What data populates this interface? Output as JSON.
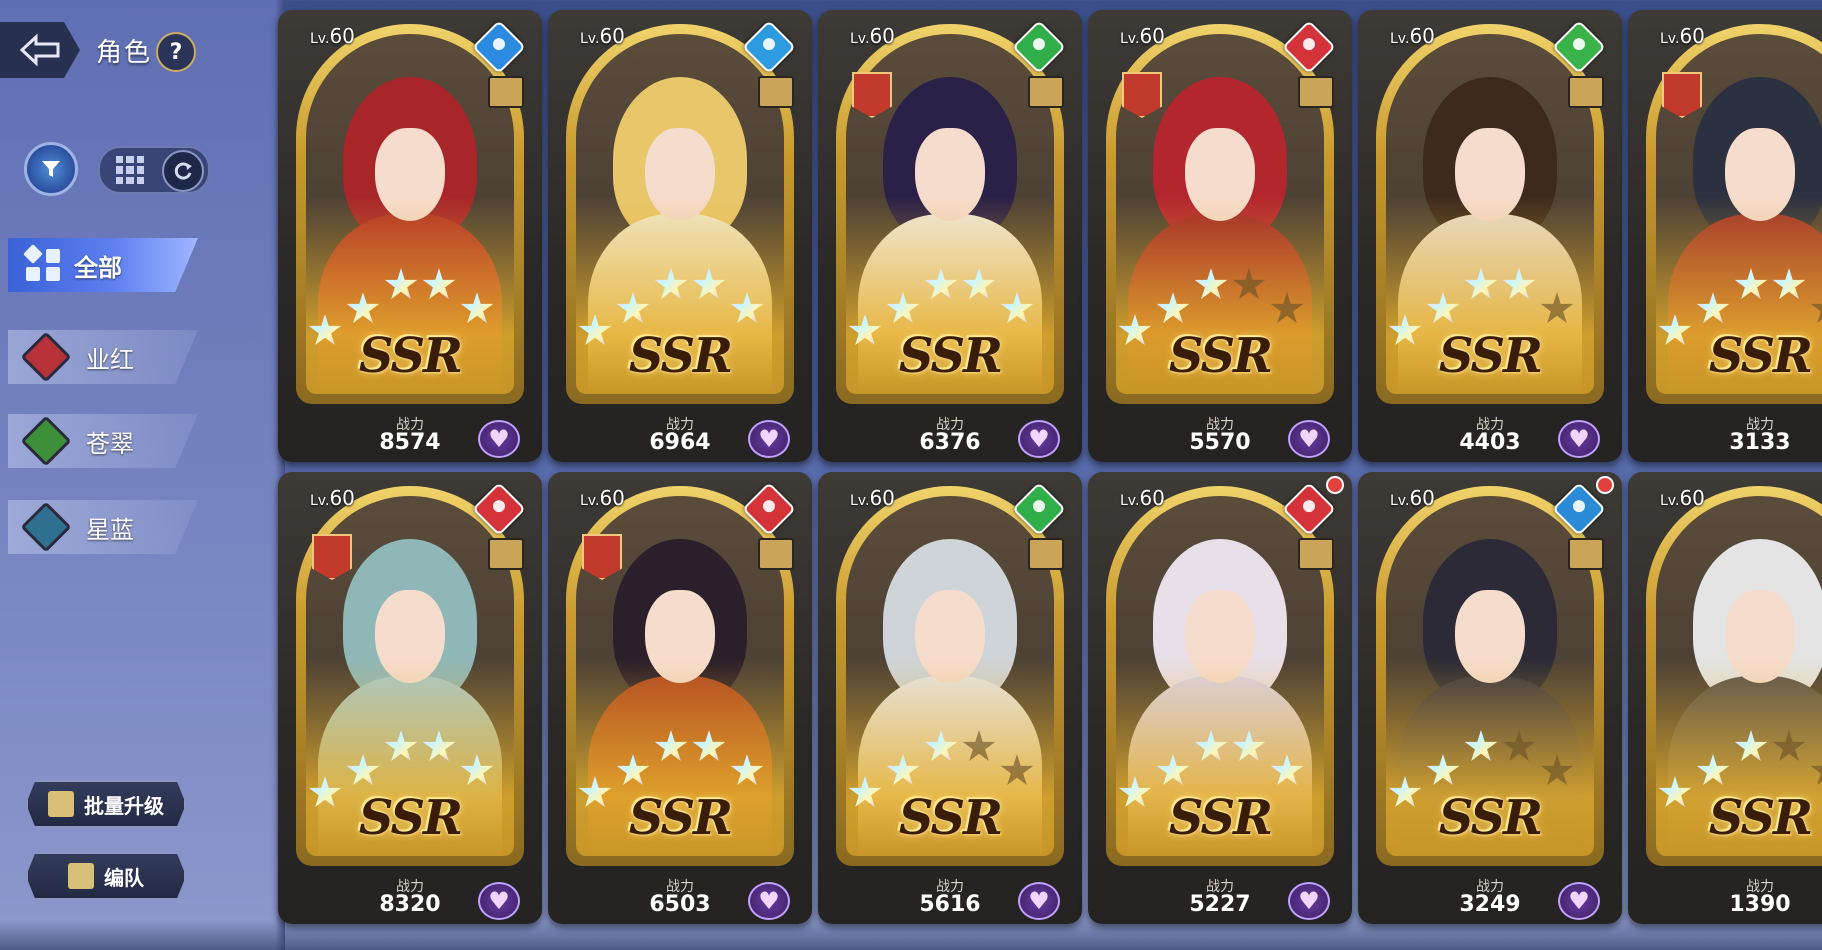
{
  "header": {
    "title": "角色",
    "help": "?"
  },
  "categories": [
    {
      "label": "全部",
      "active": true
    },
    {
      "label": "业红",
      "color": "#b8323a"
    },
    {
      "label": "苍翠",
      "color": "#3e8f3a"
    },
    {
      "label": "星蓝",
      "color": "#2f6f8f"
    }
  ],
  "buttons": {
    "batch_upgrade": "批量升级",
    "formation": "编队"
  },
  "card_common": {
    "level": "60",
    "level_prefix": "Lv.",
    "rarity": "SSR",
    "power_label": "战力"
  },
  "cards": [
    {
      "power": "8574",
      "element_color": "#2b8be0",
      "element": "water-icon",
      "badge": false,
      "stars_on": 5,
      "hair": "#a8262a",
      "body": "#b43528",
      "red_dot": false
    },
    {
      "power": "6964",
      "element_color": "#2c9be0",
      "element": "ice-icon",
      "badge": false,
      "stars_on": 5,
      "hair": "#e8c66a",
      "body": "#efe7c8",
      "red_dot": false
    },
    {
      "power": "6376",
      "element_color": "#2fae4a",
      "element": "leaf-icon",
      "badge": true,
      "stars_on": 5,
      "hair": "#2a2048",
      "body": "#f0eadc",
      "red_dot": false
    },
    {
      "power": "5570",
      "element_color": "#d4333a",
      "element": "shield-icon",
      "badge": true,
      "stars_on": 3,
      "hair": "#b3262e",
      "body": "#a32a2a",
      "red_dot": false
    },
    {
      "power": "4403",
      "element_color": "#39b24a",
      "element": "sword-icon",
      "badge": false,
      "stars_on": 4,
      "hair": "#3d2a1e",
      "body": "#e7dccb",
      "red_dot": false
    },
    {
      "power": "3133",
      "element_color": "#d4333a",
      "element": "shield-icon",
      "badge": true,
      "stars_on": 4,
      "hair": "#2b3140",
      "body": "#a2362c",
      "red_dot": false
    },
    {
      "power": "8320",
      "element_color": "#d4333a",
      "element": "sword-icon",
      "badge": true,
      "stars_on": 5,
      "hair": "#8fb7b8",
      "body": "#a9c9c9",
      "red_dot": false
    },
    {
      "power": "6503",
      "element_color": "#d4333a",
      "element": "fire-icon",
      "badge": true,
      "stars_on": 5,
      "hair": "#2a1f2a",
      "body": "#b24a22",
      "red_dot": false
    },
    {
      "power": "5616",
      "element_color": "#2fae4a",
      "element": "shield-icon",
      "badge": false,
      "stars_on": 3,
      "hair": "#cfd4d8",
      "body": "#e6e6e6",
      "red_dot": false
    },
    {
      "power": "5227",
      "element_color": "#d4333a",
      "element": "sword-icon",
      "badge": false,
      "stars_on": 5,
      "hair": "#e8dfe8",
      "body": "#d9d2e6",
      "red_dot": true
    },
    {
      "power": "3249",
      "element_color": "#2c8bd6",
      "element": "shield-icon",
      "badge": false,
      "stars_on": 3,
      "hair": "#2b2a36",
      "body": "#3a3844",
      "red_dot": true
    },
    {
      "power": "1390",
      "element_color": "#d4333a",
      "element": "sword-icon",
      "badge": false,
      "stars_on": 3,
      "hair": "#e4e4e4",
      "body": "#5a5550",
      "red_dot": false
    }
  ]
}
